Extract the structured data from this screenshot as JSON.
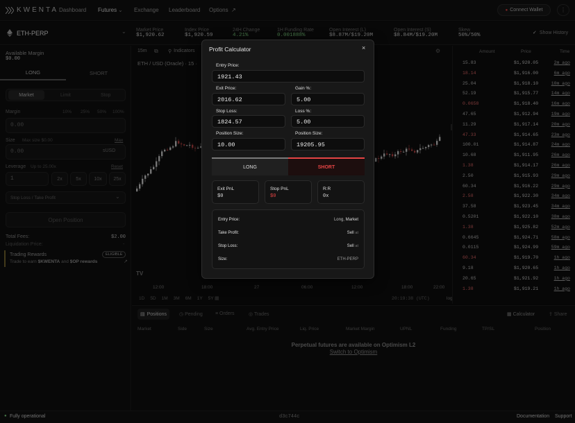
{
  "nav": {
    "logo": "KWENTA",
    "items": [
      "Dashboard",
      "Futures",
      "Exchange",
      "Leaderboard",
      "Options"
    ],
    "connect_wallet": "Connect Wallet",
    "more": "⋮"
  },
  "market": {
    "symbol": "ETH-PERP",
    "stats": [
      {
        "label": "Market Price",
        "value": "$1,920.62"
      },
      {
        "label": "Index Price",
        "value": "$1,920.59"
      },
      {
        "label": "24H Change",
        "value": "4.21%"
      },
      {
        "label": "1H Funding Rate",
        "value": "0.001888%"
      },
      {
        "label": "Open Interest (L)",
        "value": "$8.87M/$19.20M"
      },
      {
        "label": "Open Interest (S)",
        "value": "$8.84M/$19.20M"
      },
      {
        "label": "Skew",
        "value": "50%/50%"
      }
    ],
    "show_history": "Show History"
  },
  "left": {
    "available_margin": "Available Margin",
    "margin_value": "$0.00",
    "long": "LONG",
    "short": "SHORT",
    "order_types": [
      "Market",
      "Limit",
      "Stop"
    ],
    "margin_label": "Margin",
    "margin_pcts": [
      "10%",
      "25%",
      "50%",
      "100%"
    ],
    "margin_input": "0.00",
    "size_label": "Size",
    "size_max": "Max size $0.00",
    "size_max_link": "Max",
    "size_input": "0.00",
    "size_unit": "sUSD",
    "leverage_label": "Leverage",
    "leverage_range": "Up to 25.00x",
    "leverage_reset": "Reset",
    "leverage_value": "1",
    "lev_opts": [
      "2x",
      "5x",
      "10x",
      "25x"
    ],
    "sltp": "Stop Loss / Take Profit",
    "open_position": "Open Position",
    "total_fees": "Total Fees:",
    "total_fees_value": "$2.00",
    "liq_price": "Liquidation Price:",
    "liq_value": "-",
    "trading_rewards": "Trading Rewards",
    "eligible": "ELIGIBLE",
    "rewards_text_a": "Trade to earn",
    "rewards_kwenta": "$KWENTA",
    "rewards_and": "and",
    "rewards_op": "$OP rewards"
  },
  "chart": {
    "timeframe": "15m",
    "indicators": "Indicators",
    "pair": "ETH / USD (Oracle) · 15 ·",
    "xticks": [
      "12:00",
      "18:00",
      "27",
      "06:00",
      "12:00",
      "18:00",
      "22:00"
    ],
    "yticks": [
      "1980.00",
      "1970.00",
      "1960.00",
      "1950.00",
      "1940.00",
      "1930.00",
      "1920.00",
      "1910.00",
      "1900.00",
      "1890.00",
      "1880.00",
      "1870.00",
      "1860.00",
      "1850.00",
      "1840.00",
      "1830.00",
      "1820.00",
      "1810.00",
      "1800.00"
    ],
    "price_tag": "1920.60",
    "ranges": [
      "1D",
      "5D",
      "1M",
      "3M",
      "6M",
      "1Y",
      "5Y"
    ],
    "clock": "20:19:38 (UTC)",
    "log": "log",
    "auto": "auto"
  },
  "orderbook": {
    "headers": [
      "Amount",
      "Price",
      "Time"
    ],
    "rows": [
      {
        "amount": "15.83",
        "price": "$1,920.05",
        "time": "2m ago"
      },
      {
        "amount": "18.14",
        "price": "$1,916.00",
        "time": "6m ago"
      },
      {
        "amount": "25.04",
        "price": "$1,918.10",
        "time": "10m ago"
      },
      {
        "amount": "52.19",
        "price": "$1,915.77",
        "time": "14m ago"
      },
      {
        "amount": "0.0658",
        "price": "$1,918.40",
        "time": "16m ago"
      },
      {
        "amount": "47.65",
        "price": "$1,912.94",
        "time": "19m ago"
      },
      {
        "amount": "11.29",
        "price": "$1,917.14",
        "time": "20m ago"
      },
      {
        "amount": "47.33",
        "price": "$1,914.65",
        "time": "23m ago"
      },
      {
        "amount": "100.01",
        "price": "$1,914.87",
        "time": "24m ago"
      },
      {
        "amount": "10.68",
        "price": "$1,911.95",
        "time": "26m ago"
      },
      {
        "amount": "1.38",
        "price": "$1,914.17",
        "time": "26m ago"
      },
      {
        "amount": "2.50",
        "price": "$1,915.93",
        "time": "29m ago"
      },
      {
        "amount": "60.34",
        "price": "$1,916.22",
        "time": "29m ago"
      },
      {
        "amount": "2.58",
        "price": "$1,922.30",
        "time": "34m ago"
      },
      {
        "amount": "37.58",
        "price": "$1,923.45",
        "time": "34m ago"
      },
      {
        "amount": "0.5201",
        "price": "$1,922.10",
        "time": "38m ago"
      },
      {
        "amount": "1.38",
        "price": "$1,925.82",
        "time": "52m ago"
      },
      {
        "amount": "0.6645",
        "price": "$1,924.71",
        "time": "58m ago"
      },
      {
        "amount": "0.0115",
        "price": "$1,924.99",
        "time": "59m ago"
      },
      {
        "amount": "60.34",
        "price": "$1,919.70",
        "time": "1h ago"
      },
      {
        "amount": "9.18",
        "price": "$1,920.65",
        "time": "1h ago"
      },
      {
        "amount": "20.65",
        "price": "$1,921.92",
        "time": "1h ago"
      },
      {
        "amount": "1.38",
        "price": "$1,919.21",
        "time": "1h ago"
      }
    ]
  },
  "bottom": {
    "tabs": [
      "Positions",
      "Pending",
      "Orders",
      "Trades"
    ],
    "right_tabs": [
      "Calculator",
      "Share"
    ],
    "columns": [
      "Market",
      "Side",
      "Size",
      "Avg. Entry Price",
      "Liq. Price",
      "Market Margin",
      "UPNL",
      "Funding",
      "TP/SL",
      "Position"
    ],
    "empty_msg": "Perpetual futures are available on Optimism L2",
    "switch_link": "Switch to Optimism"
  },
  "footer": {
    "status": "Fully operational",
    "hash": "d3c744c",
    "docs": "Documentation",
    "support": "Support"
  },
  "calc": {
    "title": "Profit Calculator",
    "close": "×",
    "entry_label": "Entry Price:",
    "entry_value": "1921.43",
    "exit_label": "Exit Price:",
    "exit_value": "2016.62",
    "gain_label": "Gain %:",
    "gain_value": "5.00",
    "stop_label": "Stop Loss:",
    "stop_value": "1824.57",
    "loss_label": "Loss %:",
    "loss_value": "5.00",
    "pos_size_label": "Position Size:",
    "pos_size_value": "10.00",
    "pos_size2_label": "Position Size:",
    "pos_size2_value": "19205.95",
    "long": "LONG",
    "short": "SHORT",
    "exit_pnl_label": "Exit PnL",
    "exit_pnl_value": "$0",
    "stop_pnl_label": "Stop PnL",
    "stop_pnl_value": "$0",
    "rr_label": "R:R",
    "rr_value": "0x",
    "summary": {
      "entry_label": "Entry Price:",
      "entry_side": "Long,",
      "entry_type": "Market",
      "tp_label": "Take Profit:",
      "tp_side": "Sell",
      "tp_at": "at",
      "sl_label": "Stop Loss:",
      "sl_side": "Sell",
      "sl_at": "at",
      "size_label": "Size:",
      "size_value": "ETH-PERP"
    }
  },
  "colors": {
    "short_red": "#e64545",
    "positive": "#7fd482",
    "accent": "#f0b429"
  }
}
